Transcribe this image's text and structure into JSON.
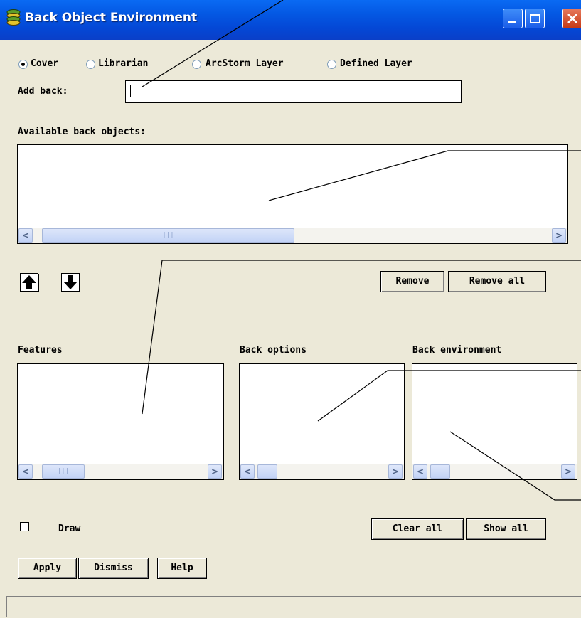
{
  "window": {
    "title": "Back Object Environment"
  },
  "source_type": {
    "options": [
      "Cover",
      "Librarian",
      "ArcStorm Layer",
      "Defined Layer"
    ],
    "selected": "Cover"
  },
  "add_back": {
    "label": "Add back:",
    "value": ""
  },
  "available": {
    "label": "Available back objects:"
  },
  "buttons": {
    "remove": "Remove",
    "remove_all": "Remove all",
    "clear_all": "Clear all",
    "show_all": "Show all",
    "apply": "Apply",
    "dismiss": "Dismiss",
    "help": "Help"
  },
  "panels": {
    "features": "Features",
    "back_options": "Back options",
    "back_environment": "Back environment"
  },
  "draw": {
    "label": "Draw",
    "checked": false
  },
  "icons": {
    "up": "up-arrow-icon",
    "down": "down-arrow-icon",
    "app": "layers-icon"
  }
}
